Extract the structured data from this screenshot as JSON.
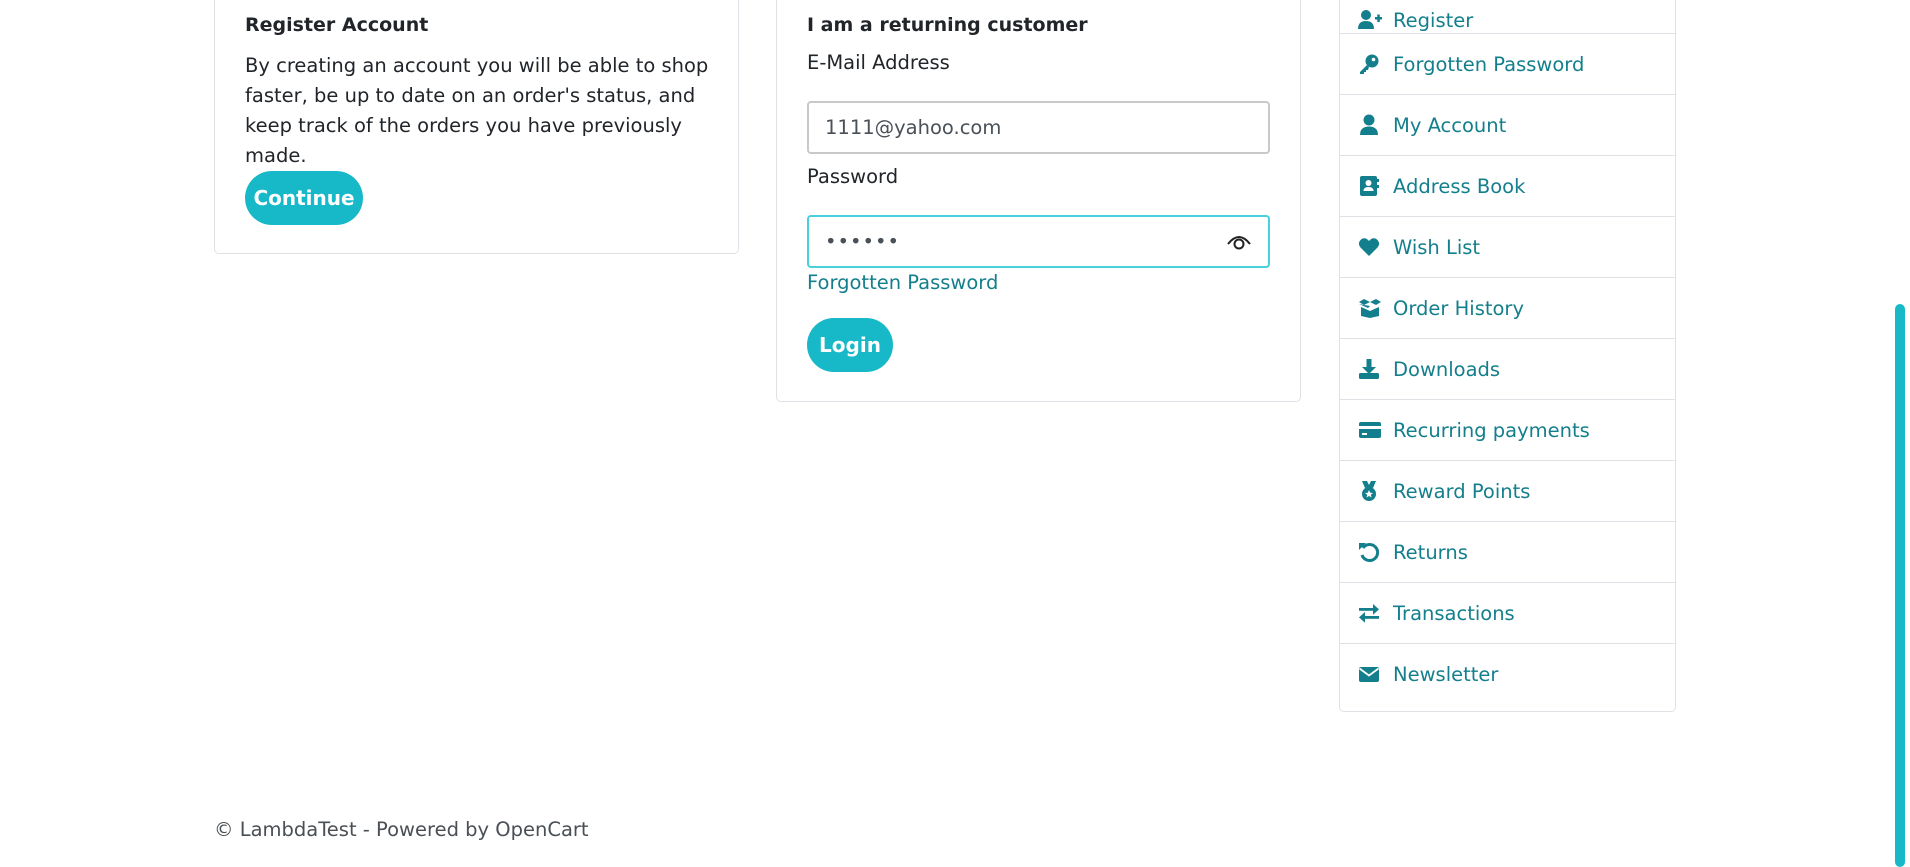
{
  "register": {
    "title": "Register Account",
    "body": "By creating an account you will be able to shop faster, be up to date on an order's status, and keep track of the orders you have previously made.",
    "continue_label": "Continue"
  },
  "login": {
    "title": "I am a returning customer",
    "email_label": "E-Mail Address",
    "email_value": "1111@yahoo.com",
    "password_label": "Password",
    "password_value": "••••••",
    "forgot_label": "Forgotten Password",
    "login_label": "Login"
  },
  "sidebar": {
    "items": [
      {
        "label": "Register",
        "icon": "user-plus-icon"
      },
      {
        "label": "Forgotten Password",
        "icon": "key-icon"
      },
      {
        "label": "My Account",
        "icon": "user-icon"
      },
      {
        "label": "Address Book",
        "icon": "address-book-icon"
      },
      {
        "label": "Wish List",
        "icon": "heart-icon"
      },
      {
        "label": "Order History",
        "icon": "box-open-icon"
      },
      {
        "label": "Downloads",
        "icon": "download-icon"
      },
      {
        "label": "Recurring payments",
        "icon": "credit-card-icon"
      },
      {
        "label": "Reward Points",
        "icon": "medal-icon"
      },
      {
        "label": "Returns",
        "icon": "undo-icon"
      },
      {
        "label": "Transactions",
        "icon": "exchange-icon"
      },
      {
        "label": "Newsletter",
        "icon": "envelope-icon"
      }
    ]
  },
  "footer": {
    "text": "© LambdaTest - Powered by OpenCart"
  },
  "colors": {
    "accent": "#17b9c8",
    "link": "#147f8c",
    "focus_border": "#48d1db"
  }
}
